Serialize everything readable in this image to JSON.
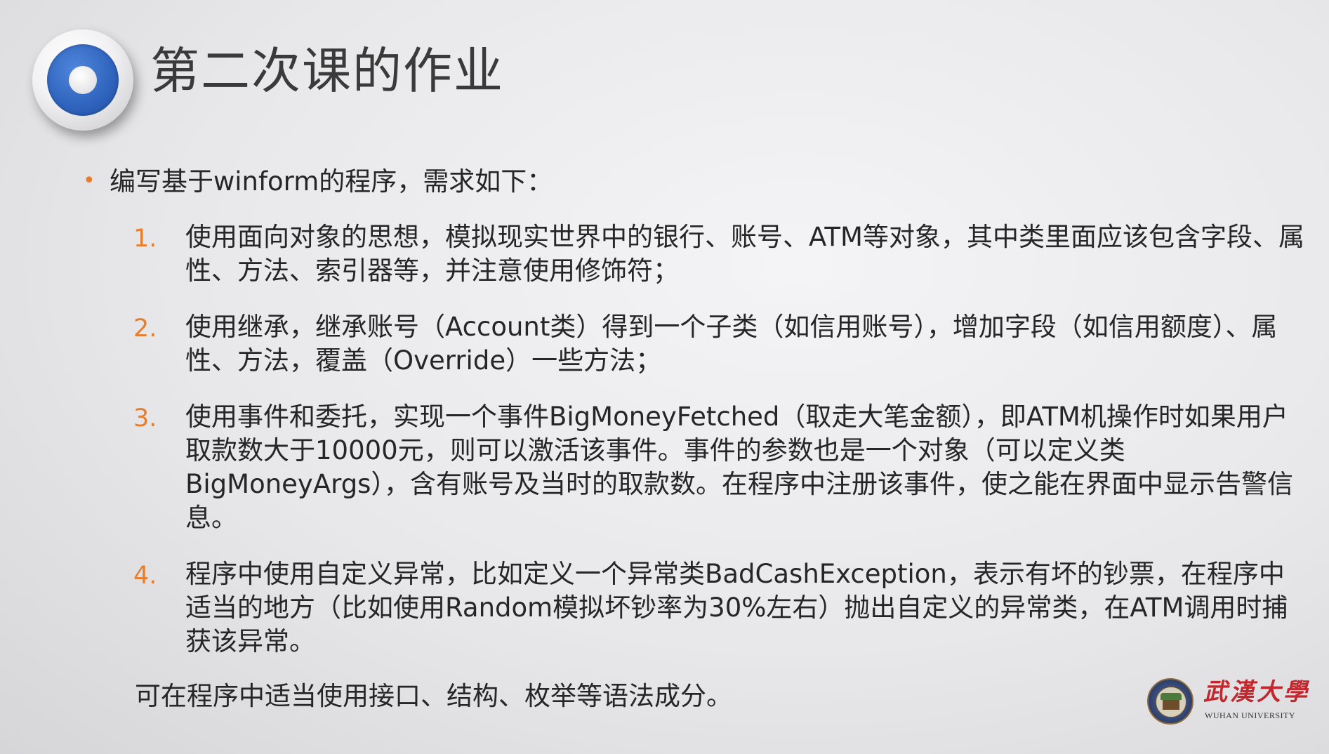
{
  "slide": {
    "title": "第二次课的作业",
    "intro": {
      "bullet": "•",
      "text": "编写基于winform的程序，需求如下："
    },
    "items": [
      {
        "number": "1.",
        "text": "使用面向对象的思想，模拟现实世界中的银行、账号、ATM等对象，其中类里面应该包含字段、属性、方法、索引器等，并注意使用修饰符；"
      },
      {
        "number": "2.",
        "text": "使用继承，继承账号（Account类）得到一个子类（如信用账号），增加字段（如信用额度）、属性、方法，覆盖（Override）一些方法；"
      },
      {
        "number": "3.",
        "text": "使用事件和委托，实现一个事件BigMoneyFetched（取走大笔金额），即ATM机操作时如果用户取款数大于10000元，则可以激活该事件。事件的参数也是一个对象（可以定义类BigMoneyArgs），含有账号及当时的取款数。在程序中注册该事件，使之能在界面中显示告警信息。"
      },
      {
        "number": "4.",
        "text": "程序中使用自定义异常，比如定义一个异常类BadCashException，表示有坏的钞票，在程序中适当的地方（比如使用Random模拟坏钞率为30%左右）抛出自定义的异常类，在ATM调用时捕获该异常。"
      }
    ],
    "footnote": "可在程序中适当使用接口、结构、枚举等语法成分。"
  },
  "logo": {
    "name": "武漢大學",
    "english": "WUHAN UNIVERSITY"
  },
  "colors": {
    "accent": "#e87e2c",
    "emblem_blue": "#2f63bd",
    "logo_red": "#c1272d",
    "text": "#262626"
  },
  "icons": {
    "title_emblem": "circle-emblem-icon",
    "logo_seal": "university-seal-icon"
  }
}
